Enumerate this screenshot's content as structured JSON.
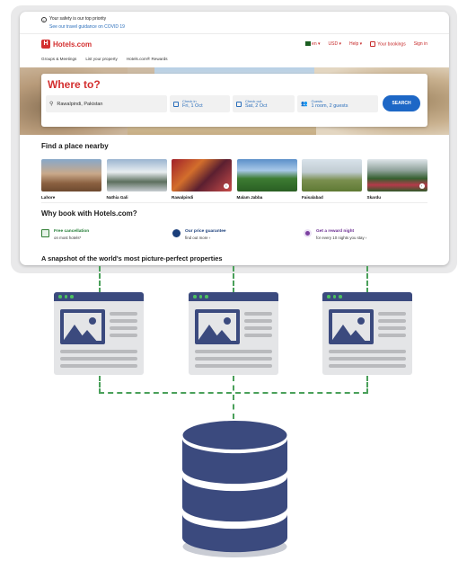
{
  "notice": {
    "safety_text": "Your safety is our top priority",
    "covid_link": "See our travel guidance on COVID 19"
  },
  "header": {
    "logo_text": "Hotels.com",
    "language": "en",
    "currency": "USD",
    "help": "Help",
    "bookings": "Your bookings",
    "sign_in": "Sign in"
  },
  "sublinks": [
    "Groups & Meetings",
    "List your property",
    "Hotels.com® Rewards"
  ],
  "search": {
    "title": "Where to?",
    "destination": "Rawalpindi, Pakistan",
    "checkin_label": "Check in",
    "checkin_value": "Fri, 1 Oct",
    "checkout_label": "Check out",
    "checkout_value": "Sat, 2 Oct",
    "guests_label": "Guests",
    "guests_value": "1 room, 2 guests",
    "button": "SEARCH"
  },
  "nearby": {
    "title": "Find a place nearby",
    "places": [
      {
        "name": "Lahore"
      },
      {
        "name": "Nathia Gali"
      },
      {
        "name": "Rawalpindi"
      },
      {
        "name": "Malam Jabba"
      },
      {
        "name": "Faisalabad"
      },
      {
        "name": "Skardu"
      }
    ]
  },
  "why": {
    "title": "Why book with Hotels.com?",
    "items": [
      {
        "title": "Free cancellation",
        "subtitle": "on most hotels*"
      },
      {
        "title": "Our price guarantee",
        "subtitle": "find out more"
      },
      {
        "title": "Get a reward night",
        "subtitle": "for every 10 nights you stay"
      }
    ]
  },
  "snapshot_title": "A snapshot of the world's most picture-perfect properties",
  "colors": {
    "brand_red": "#d32f2f",
    "link_blue": "#2a6ebb",
    "button_blue": "#1d67c6",
    "diagram_navy": "#3b4a7e",
    "connector_green": "#4aa05a"
  }
}
